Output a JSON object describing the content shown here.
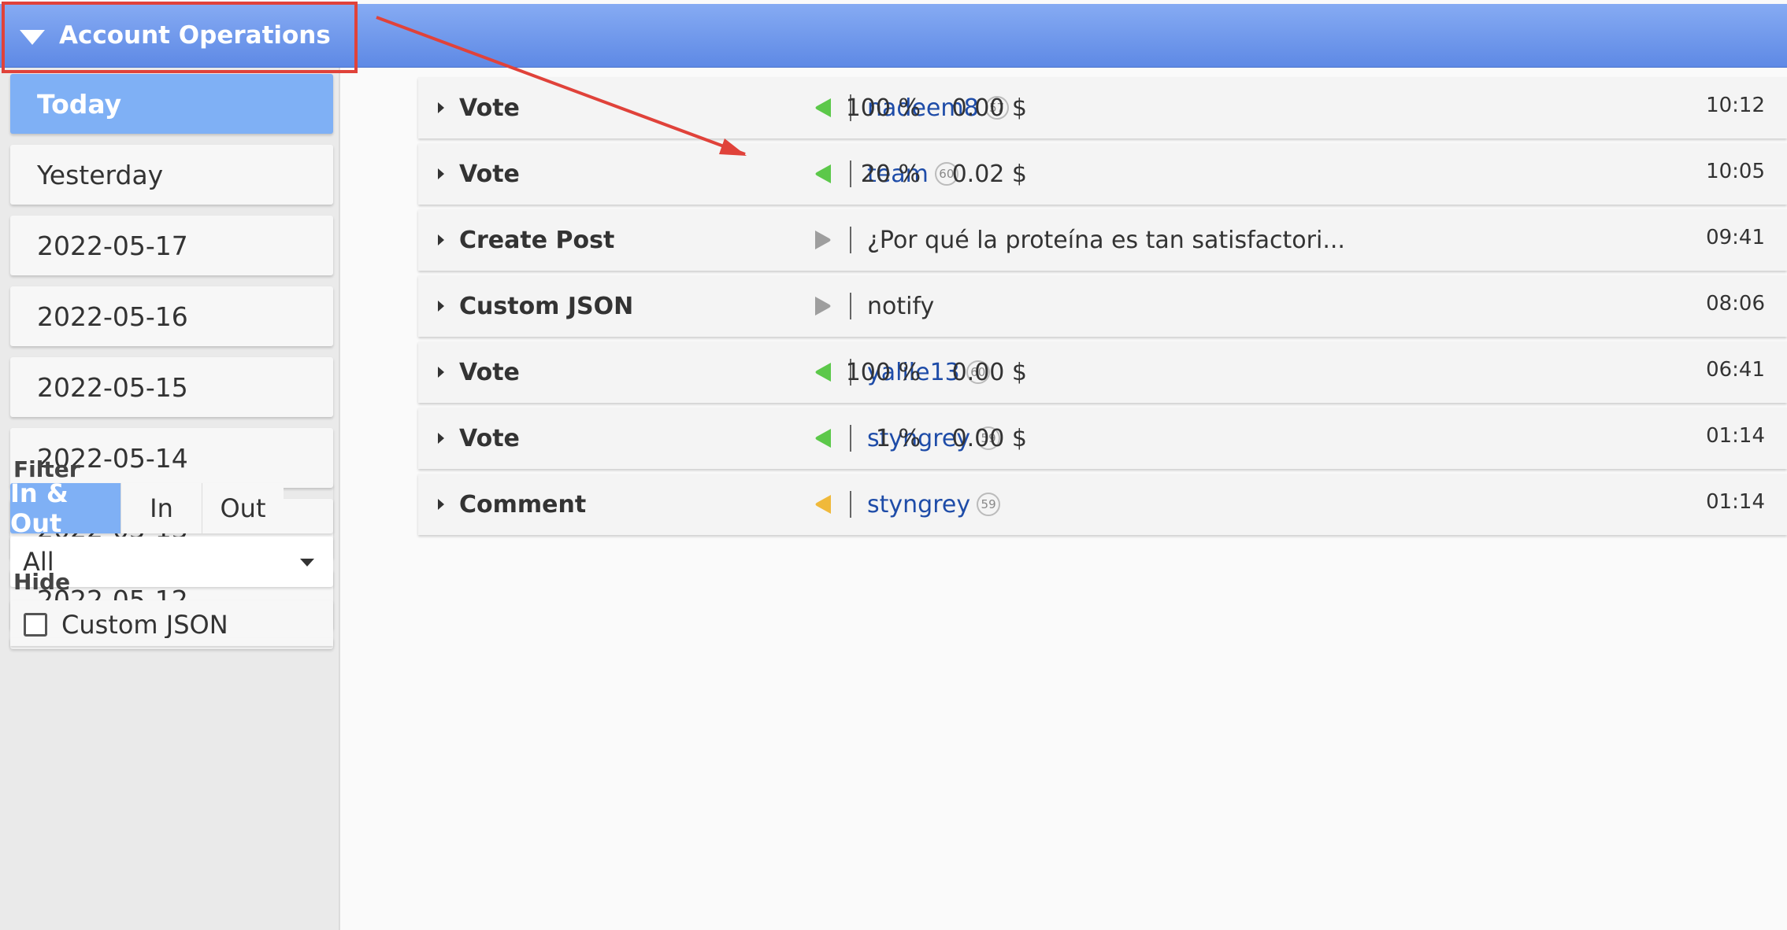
{
  "panel": {
    "title": "Account Operations"
  },
  "sidebar": {
    "dates": [
      {
        "label": "Today",
        "active": true
      },
      {
        "label": "Yesterday",
        "active": false
      },
      {
        "label": "2022-05-17",
        "active": false
      },
      {
        "label": "2022-05-16",
        "active": false
      },
      {
        "label": "2022-05-15",
        "active": false
      },
      {
        "label": "2022-05-14",
        "active": false
      },
      {
        "label": "2022-05-13",
        "active": false
      },
      {
        "label": "2022-05-12",
        "active": false
      }
    ],
    "filter_label": "Filter",
    "filter_options": [
      "In & Out",
      "In",
      "Out"
    ],
    "filter_selected": "In & Out",
    "type_select": "All",
    "hide_label": "Hide",
    "hide_items": [
      {
        "label": "Custom JSON",
        "checked": false
      }
    ]
  },
  "operations": [
    {
      "type": "Vote",
      "direction": "in",
      "direction_color": "#5cc84a",
      "target": "nadeem8",
      "target_is_account": true,
      "reputation": "57",
      "weight": "100 %",
      "value": "0.00 $",
      "time": "10:12"
    },
    {
      "type": "Vote",
      "direction": "in",
      "direction_color": "#5cc84a",
      "target": "team",
      "target_is_account": true,
      "reputation": "60",
      "weight": "20 %",
      "value": "0.02 $",
      "time": "10:05"
    },
    {
      "type": "Create Post",
      "direction": "out",
      "direction_color": "#9e9e9e",
      "target": "¿Por qué la proteína es tan satisfactori...",
      "target_is_account": false,
      "reputation": "",
      "weight": "",
      "value": "",
      "time": "09:41"
    },
    {
      "type": "Custom JSON",
      "direction": "out",
      "direction_color": "#9e9e9e",
      "target": "notify",
      "target_is_account": false,
      "reputation": "",
      "weight": "",
      "value": "",
      "time": "08:06"
    },
    {
      "type": "Vote",
      "direction": "in",
      "direction_color": "#5cc84a",
      "target": "yalile13",
      "target_is_account": true,
      "reputation": "60",
      "weight": "100 %",
      "value": "0.00 $",
      "time": "06:41"
    },
    {
      "type": "Vote",
      "direction": "in",
      "direction_color": "#5cc84a",
      "target": "styngrey",
      "target_is_account": true,
      "reputation": "59",
      "weight": "1 %",
      "value": "0.00 $",
      "time": "01:14"
    },
    {
      "type": "Comment",
      "direction": "in",
      "direction_color": "#f0b93a",
      "target": "styngrey",
      "target_is_account": true,
      "reputation": "59",
      "weight": "",
      "value": "",
      "time": "01:14"
    }
  ],
  "colors": {
    "accent": "#7fb0f5",
    "header": "#6e97ec",
    "account_link": "#1e4ca8",
    "annotation": "#e0423a"
  }
}
